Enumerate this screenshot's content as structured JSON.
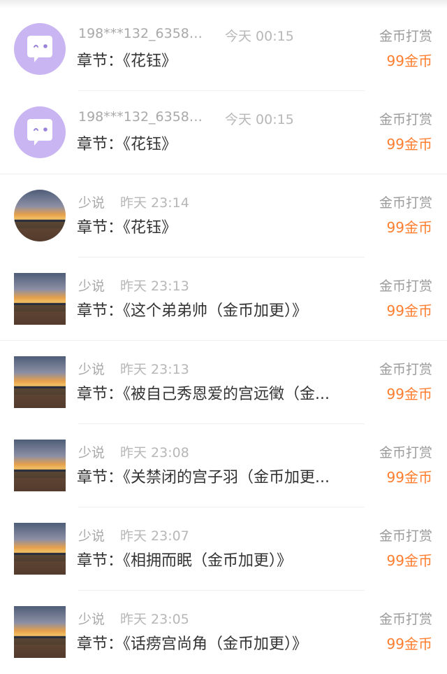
{
  "records": [
    {
      "avatar": "chat-bubble-icon",
      "name": "198***132_63588...",
      "time": "今天 00:15",
      "chapter": "章节：《花钰》",
      "type": "金币打赏",
      "amount": "99金币"
    },
    {
      "avatar": "chat-bubble-icon",
      "name": "198***132_63588...",
      "time": "今天 00:15",
      "chapter": "章节：《花钰》",
      "type": "金币打赏",
      "amount": "99金币"
    },
    {
      "avatar": "sunset-photo",
      "name": "少说",
      "time": "昨天 23:14",
      "chapter": "章节：《花钰》",
      "type": "金币打赏",
      "amount": "99金币"
    },
    {
      "avatar": "sunset-photo",
      "name": "少说",
      "time": "昨天 23:13",
      "chapter": "章节：《这个弟弟帅（金币加更）》",
      "type": "金币打赏",
      "amount": "99金币"
    },
    {
      "avatar": "sunset-photo",
      "name": "少说",
      "time": "昨天 23:13",
      "chapter": "章节：《被自己秀恩爱的宫远徵（金...",
      "type": "金币打赏",
      "amount": "99金币"
    },
    {
      "avatar": "sunset-photo",
      "name": "少说",
      "time": "昨天 23:08",
      "chapter": "章节：《关禁闭的宫子羽（金币加更...",
      "type": "金币打赏",
      "amount": "99金币"
    },
    {
      "avatar": "sunset-photo",
      "name": "少说",
      "time": "昨天 23:07",
      "chapter": "章节：《相拥而眠（金币加更）》",
      "type": "金币打赏",
      "amount": "99金币"
    },
    {
      "avatar": "sunset-photo",
      "name": "少说",
      "time": "昨天 23:05",
      "chapter": "章节：《话痨宫尚角（金币加更）》",
      "type": "金币打赏",
      "amount": "99金币"
    }
  ],
  "colors": {
    "accent": "#ff7d2e",
    "avatar_purple": "#c9b5f2"
  }
}
